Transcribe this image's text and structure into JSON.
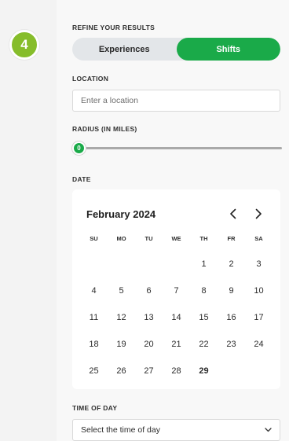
{
  "step": {
    "number": "4"
  },
  "filters": {
    "heading": "REFINE YOUR RESULTS",
    "toggle": {
      "options": [
        "Experiences",
        "Shifts"
      ],
      "selected": "Shifts"
    },
    "location": {
      "label": "LOCATION",
      "placeholder": "Enter a location",
      "value": ""
    },
    "radius": {
      "label": "RADIUS (IN MILES)",
      "value": "0",
      "fraction": 0
    },
    "date": {
      "label": "DATE",
      "calendar": {
        "month_label": "February 2024",
        "weekdays": [
          "SU",
          "MO",
          "TU",
          "WE",
          "TH",
          "FR",
          "SA"
        ],
        "leading_blanks": 4,
        "days": [
          "1",
          "2",
          "3",
          "4",
          "5",
          "6",
          "7",
          "8",
          "9",
          "10",
          "11",
          "12",
          "13",
          "14",
          "15",
          "16",
          "17",
          "18",
          "19",
          "20",
          "21",
          "22",
          "23",
          "24",
          "25",
          "26",
          "27",
          "28",
          "29"
        ],
        "today": "29",
        "prev_icon": "chevron-left-icon",
        "next_icon": "chevron-right-icon"
      }
    },
    "time_of_day": {
      "label": "TIME OF DAY",
      "placeholder": "Select the time of day",
      "icon": "chevron-down-icon"
    }
  },
  "colors": {
    "accent_green": "#1aaa49",
    "badge_green": "#86bd2b"
  }
}
